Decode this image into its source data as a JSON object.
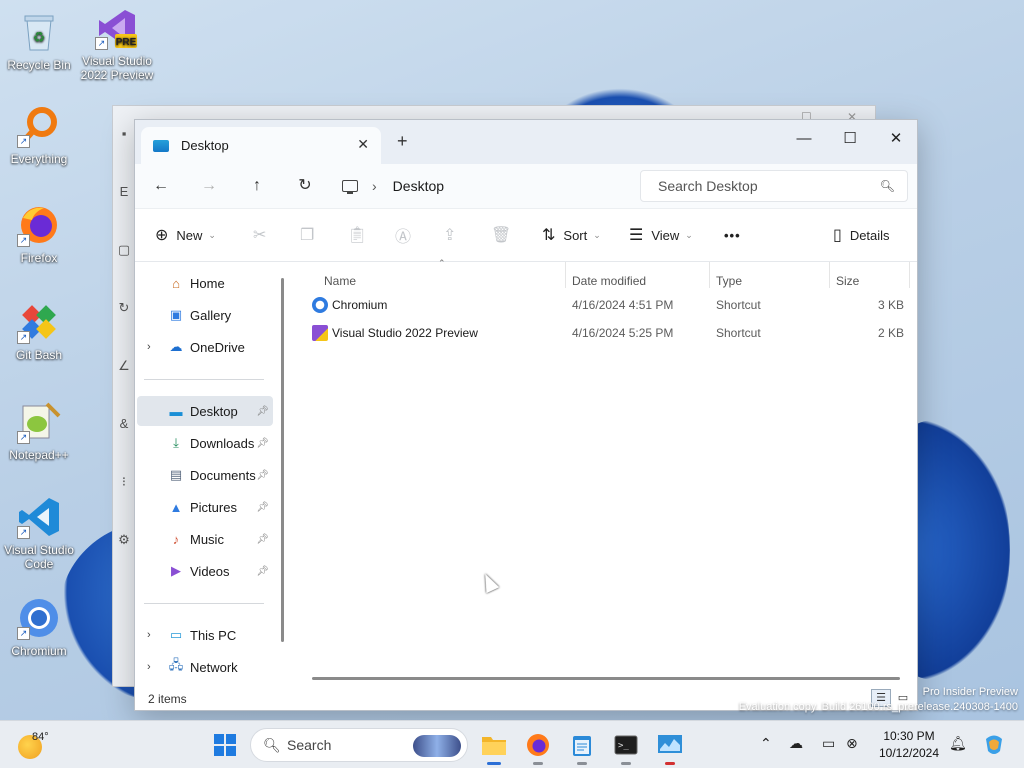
{
  "desktop": {
    "icons": [
      {
        "label": "Recycle Bin",
        "icon": "recycle-bin-icon"
      },
      {
        "label": "Visual Studio 2022 Preview",
        "icon": "visual-studio-preview-icon",
        "badge": "PRE"
      },
      {
        "label": "Everything",
        "icon": "everything-search-icon"
      },
      {
        "label": "Firefox",
        "icon": "firefox-icon"
      },
      {
        "label": "Git Bash",
        "icon": "git-bash-icon"
      },
      {
        "label": "Notepad++",
        "icon": "notepad-plus-plus-icon"
      },
      {
        "label": "Visual Studio Code",
        "icon": "vscode-icon"
      },
      {
        "label": "Chromium",
        "icon": "chromium-icon"
      }
    ],
    "watermark": {
      "line1": "Pro Insider Preview",
      "line2": "Evaluation copy. Build 26100.rs_prerelease.240308-1400"
    }
  },
  "explorer": {
    "tab": {
      "title": "Desktop",
      "close": "✕"
    },
    "new_tab": "+",
    "window_controls": {
      "minimize": "—",
      "maximize": "☐",
      "close": "✕"
    },
    "nav": {
      "back": "←",
      "forward": "→",
      "up": "↑",
      "refresh": "↻"
    },
    "breadcrumb": {
      "separator": "›",
      "current": "Desktop"
    },
    "search": {
      "placeholder": "Search Desktop"
    },
    "commands": {
      "new": "New",
      "sort": "Sort",
      "view": "View",
      "more": "•••",
      "details": "Details"
    },
    "sidebar": {
      "items": [
        {
          "label": "Home",
          "icon": "home-icon"
        },
        {
          "label": "Gallery",
          "icon": "gallery-icon"
        },
        {
          "label": "OneDrive",
          "icon": "onedrive-icon",
          "expandable": true
        },
        {
          "label": "Desktop",
          "icon": "desktop-folder-icon",
          "pinned": true,
          "selected": true
        },
        {
          "label": "Downloads",
          "icon": "downloads-icon",
          "pinned": true
        },
        {
          "label": "Documents",
          "icon": "documents-icon",
          "pinned": true
        },
        {
          "label": "Pictures",
          "icon": "pictures-icon",
          "pinned": true
        },
        {
          "label": "Music",
          "icon": "music-icon",
          "pinned": true
        },
        {
          "label": "Videos",
          "icon": "videos-icon",
          "pinned": true
        },
        {
          "label": "This PC",
          "icon": "this-pc-icon",
          "expandable": true
        },
        {
          "label": "Network",
          "icon": "network-icon",
          "expandable": true
        }
      ]
    },
    "columns": {
      "name": "Name",
      "date": "Date modified",
      "type": "Type",
      "size": "Size"
    },
    "files": [
      {
        "name": "Chromium",
        "date": "4/16/2024 4:51 PM",
        "type": "Shortcut",
        "size": "3 KB",
        "icon": "chromium-icon",
        "color": "#2f7be0"
      },
      {
        "name": "Visual Studio 2022 Preview",
        "date": "4/16/2024 5:25 PM",
        "type": "Shortcut",
        "size": "2 KB",
        "icon": "visual-studio-preview-icon",
        "color": "#8a4fd4"
      }
    ],
    "status": {
      "item_count": "2 items"
    }
  },
  "taskbar": {
    "weather": {
      "temp": "84°"
    },
    "search": {
      "placeholder": "Search"
    },
    "apps": [
      {
        "name": "start-button",
        "icon": "windows-logo-icon"
      },
      {
        "name": "file-explorer",
        "icon": "folder-icon",
        "active": true
      },
      {
        "name": "firefox",
        "icon": "firefox-icon"
      },
      {
        "name": "notepad",
        "icon": "notepad-icon"
      },
      {
        "name": "terminal",
        "icon": "terminal-icon"
      },
      {
        "name": "task-manager",
        "icon": "monitor-chart-icon"
      }
    ],
    "clock": {
      "time": "10:30 PM",
      "date": "10/12/2024"
    }
  },
  "colors": {
    "accent": "#2b6fd6",
    "selection": "#e1e6ec"
  }
}
